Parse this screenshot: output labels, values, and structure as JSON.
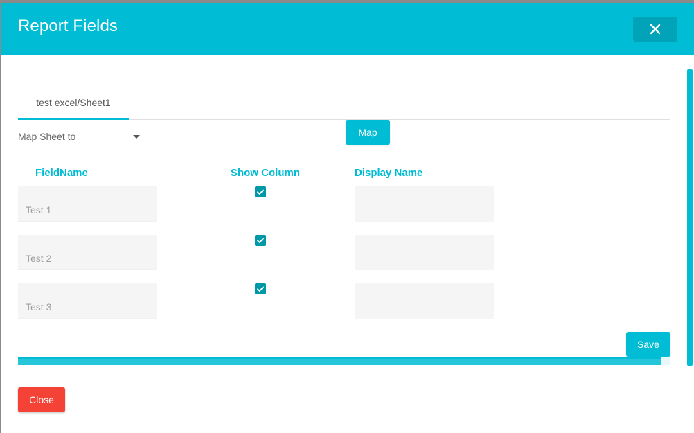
{
  "dialog": {
    "title": "Report Fields",
    "close_icon": "close-icon"
  },
  "tabs": [
    {
      "label": "test excel/Sheet1",
      "active": true
    }
  ],
  "map_sheet": {
    "label": "Map Sheet to",
    "icon": "caret-down-icon"
  },
  "buttons": {
    "map": "Map",
    "save": "Save",
    "close": "Close"
  },
  "columns": {
    "field_name": "FieldName",
    "show_column": "Show Column",
    "display_name": "Display Name"
  },
  "rows": [
    {
      "field_name": "Test 1",
      "show": true,
      "display_name": ""
    },
    {
      "field_name": "Test 2",
      "show": true,
      "display_name": ""
    },
    {
      "field_name": "Test 3",
      "show": true,
      "display_name": ""
    }
  ],
  "colors": {
    "accent": "#00bcd4",
    "checkbox": "#0097a7",
    "danger": "#f44336"
  }
}
